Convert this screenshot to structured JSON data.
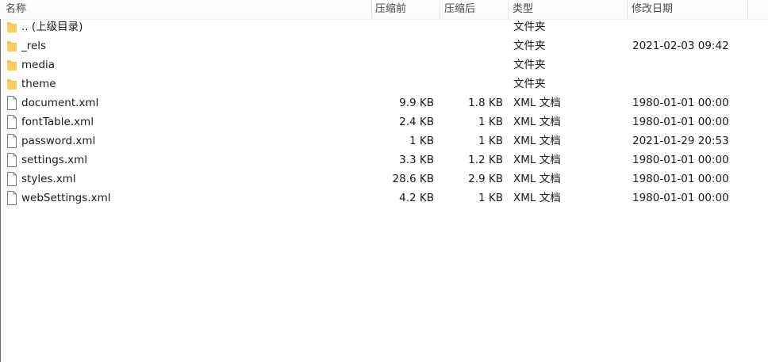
{
  "columns": {
    "name": "名称",
    "original": "压缩前",
    "compressed": "压缩后",
    "type": "类型",
    "modified": "修改日期"
  },
  "rows": [
    {
      "icon": "folder-icon",
      "name": ".. (上级目录)",
      "original": "",
      "compressed": "",
      "type": "文件夹",
      "modified": ""
    },
    {
      "icon": "folder-icon",
      "name": "_rels",
      "original": "",
      "compressed": "",
      "type": "文件夹",
      "modified": "2021-02-03 09:42"
    },
    {
      "icon": "folder-icon",
      "name": "media",
      "original": "",
      "compressed": "",
      "type": "文件夹",
      "modified": ""
    },
    {
      "icon": "folder-icon",
      "name": "theme",
      "original": "",
      "compressed": "",
      "type": "文件夹",
      "modified": ""
    },
    {
      "icon": "file-icon",
      "name": "document.xml",
      "original": "9.9 KB",
      "compressed": "1.8 KB",
      "type": "XML 文档",
      "modified": "1980-01-01 00:00"
    },
    {
      "icon": "file-icon",
      "name": "fontTable.xml",
      "original": "2.4 KB",
      "compressed": "1 KB",
      "type": "XML 文档",
      "modified": "1980-01-01 00:00"
    },
    {
      "icon": "file-icon",
      "name": "password.xml",
      "original": "1 KB",
      "compressed": "1 KB",
      "type": "XML 文档",
      "modified": "2021-01-29 20:53"
    },
    {
      "icon": "file-icon",
      "name": "settings.xml",
      "original": "3.3 KB",
      "compressed": "1.2 KB",
      "type": "XML 文档",
      "modified": "1980-01-01 00:00"
    },
    {
      "icon": "file-icon",
      "name": "styles.xml",
      "original": "28.6 KB",
      "compressed": "2.9 KB",
      "type": "XML 文档",
      "modified": "1980-01-01 00:00"
    },
    {
      "icon": "file-icon",
      "name": "webSettings.xml",
      "original": "4.2 KB",
      "compressed": "1 KB",
      "type": "XML 文档",
      "modified": "1980-01-01 00:00"
    }
  ],
  "colors": {
    "folder": "#f5c342",
    "file_border": "#7a7a7a",
    "text": "#1a1a1a"
  }
}
